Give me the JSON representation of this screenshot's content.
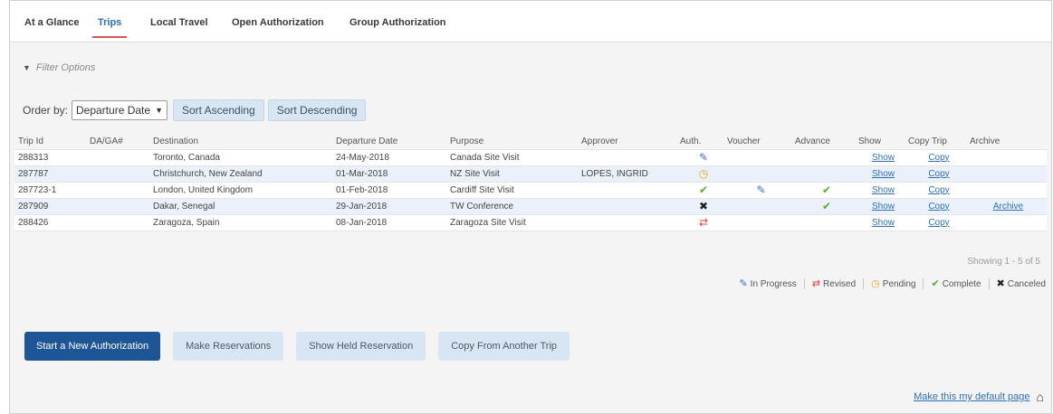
{
  "tabs": [
    {
      "label": "At a Glance",
      "active": false
    },
    {
      "label": "Trips",
      "active": true
    },
    {
      "label": "Local Travel",
      "active": false
    },
    {
      "label": "Open Authorization",
      "active": false
    },
    {
      "label": "Group Authorization",
      "active": false
    }
  ],
  "filter": {
    "label": "Filter Options",
    "icon": "chevron-down-icon"
  },
  "order": {
    "label": "Order by:",
    "selected": "Departure Date",
    "sort_ascending": "Sort Ascending",
    "sort_descending": "Sort Descending"
  },
  "table": {
    "headers": [
      "Trip Id",
      "DA/GA#",
      "Destination",
      "Departure Date",
      "Purpose",
      "Approver",
      "Auth.",
      "Voucher",
      "Advance",
      "Show",
      "Copy Trip",
      "Archive"
    ],
    "rows": [
      {
        "trip_id": "288313",
        "daga": "",
        "destination": "Toronto, Canada",
        "departure": "24-May-2018",
        "purpose": "Canada Site Visit",
        "approver": "",
        "auth": "in-progress",
        "voucher": "",
        "advance": "",
        "show": "Show",
        "copy": "Copy",
        "archive": ""
      },
      {
        "trip_id": "287787",
        "daga": "",
        "destination": "Christchurch, New Zealand",
        "departure": "01-Mar-2018",
        "purpose": "NZ Site Visit",
        "approver": "LOPES, INGRID",
        "auth": "pending",
        "voucher": "",
        "advance": "",
        "show": "Show",
        "copy": "Copy",
        "archive": ""
      },
      {
        "trip_id": "287723-1",
        "daga": "",
        "destination": "London, United Kingdom",
        "departure": "01-Feb-2018",
        "purpose": "Cardiff Site Visit",
        "approver": "",
        "auth": "complete",
        "voucher": "in-progress",
        "advance": "complete",
        "show": "Show",
        "copy": "Copy",
        "archive": ""
      },
      {
        "trip_id": "287909",
        "daga": "",
        "destination": "Dakar, Senegal",
        "departure": "29-Jan-2018",
        "purpose": "TW Conference",
        "approver": "",
        "auth": "canceled",
        "voucher": "",
        "advance": "complete",
        "show": "Show",
        "copy": "Copy",
        "archive": "Archive"
      },
      {
        "trip_id": "288426",
        "daga": "",
        "destination": "Zaragoza, Spain",
        "departure": "08-Jan-2018",
        "purpose": "Zaragoza Site Visit",
        "approver": "",
        "auth": "revised",
        "voucher": "",
        "advance": "",
        "show": "Show",
        "copy": "Copy",
        "archive": ""
      }
    ],
    "showing": "Showing 1 - 5 of 5"
  },
  "legend": [
    {
      "status": "in-progress",
      "label": "In Progress"
    },
    {
      "status": "revised",
      "label": "Revised"
    },
    {
      "status": "pending",
      "label": "Pending"
    },
    {
      "status": "complete",
      "label": "Complete"
    },
    {
      "status": "canceled",
      "label": "Canceled"
    }
  ],
  "status_icons": {
    "in-progress": {
      "glyph": "✎",
      "color": "#3b6fc6",
      "name": "pencil-icon"
    },
    "revised": {
      "glyph": "⇄",
      "color": "#e0403a",
      "name": "revised-arrows-icon"
    },
    "pending": {
      "glyph": "◷",
      "color": "#e8a317",
      "name": "clock-icon"
    },
    "complete": {
      "glyph": "✔",
      "color": "#5aab2e",
      "name": "checkmark-icon"
    },
    "canceled": {
      "glyph": "✖",
      "color": "#222222",
      "name": "x-icon"
    }
  },
  "actions": {
    "start_new": "Start a New Authorization",
    "make_reservations": "Make Reservations",
    "show_held": "Show Held Reservation",
    "copy_from": "Copy From Another Trip"
  },
  "footer": {
    "default_page": "Make this my default page",
    "icon": "home-icon"
  },
  "colors": {
    "accent": "#2f6fb3",
    "primary_button": "#1d5597",
    "light_button": "#d8e6f4",
    "active_tab_underline": "#d9534f"
  }
}
